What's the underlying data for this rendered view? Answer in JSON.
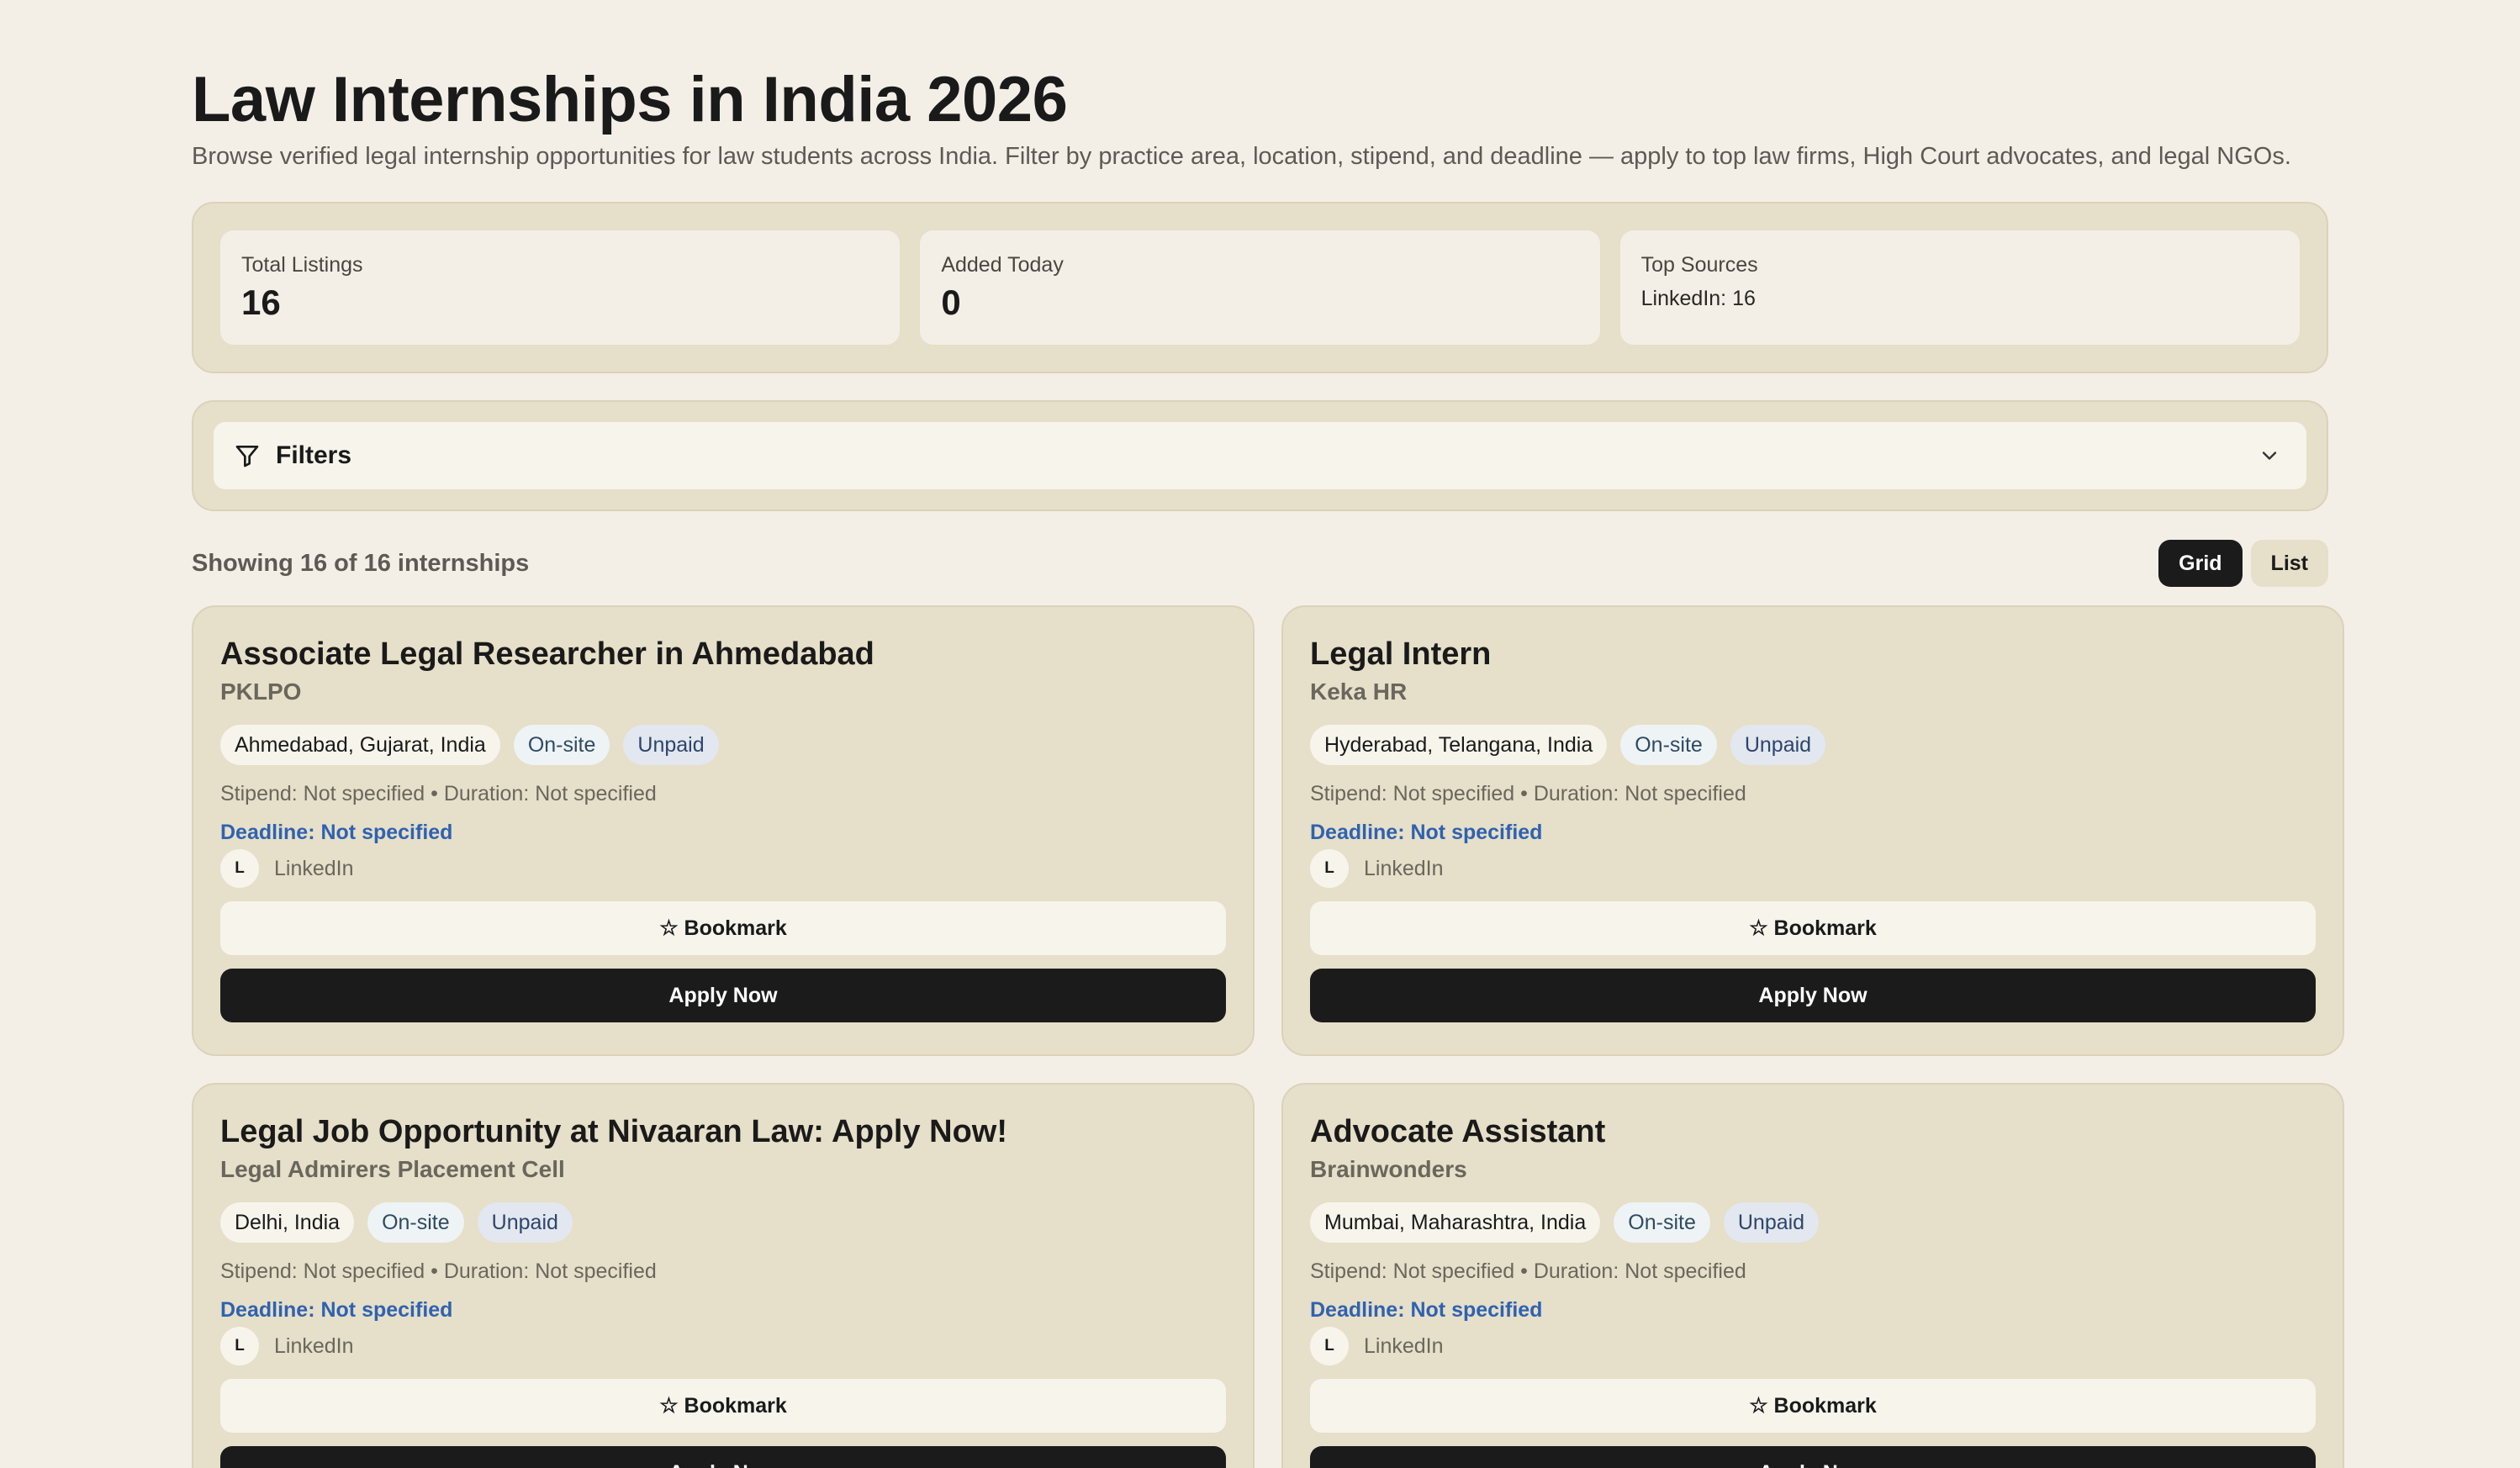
{
  "header": {
    "title": "Law Internships in India 2026",
    "description": "Browse verified legal internship opportunities for law students across India. Filter by practice area, location, stipend, and deadline — apply to top law firms, High Court advocates, and legal NGOs."
  },
  "stats": {
    "total_label": "Total Listings",
    "total_value": "16",
    "today_label": "Added Today",
    "today_value": "0",
    "sources_label": "Top Sources",
    "sources_value": "LinkedIn: 16"
  },
  "filters": {
    "label": "Filters"
  },
  "toolbar": {
    "showing": "Showing 16 of 16 internships",
    "grid_label": "Grid",
    "list_label": "List"
  },
  "cards": [
    {
      "title": "Associate Legal Researcher in Ahmedabad",
      "company": "PKLPO",
      "location": "Ahmedabad, Gujarat, India",
      "mode": "On-site",
      "pay": "Unpaid",
      "meta": "Stipend: Not specified • Duration: Not specified",
      "deadline": "Deadline: Not specified",
      "source_initial": "L",
      "source": "LinkedIn",
      "bookmark": "☆ Bookmark",
      "apply": "Apply Now"
    },
    {
      "title": "Legal Intern",
      "company": "Keka HR",
      "location": "Hyderabad, Telangana, India",
      "mode": "On-site",
      "pay": "Unpaid",
      "meta": "Stipend: Not specified • Duration: Not specified",
      "deadline": "Deadline: Not specified",
      "source_initial": "L",
      "source": "LinkedIn",
      "bookmark": "☆ Bookmark",
      "apply": "Apply Now"
    },
    {
      "title": "Legal Job Opportunity at Nivaaran Law: Apply Now!",
      "company": "Legal Admirers Placement Cell",
      "location": "Delhi, India",
      "mode": "On-site",
      "pay": "Unpaid",
      "meta": "Stipend: Not specified • Duration: Not specified",
      "deadline": "Deadline: Not specified",
      "source_initial": "L",
      "source": "LinkedIn",
      "bookmark": "☆ Bookmark",
      "apply": "Apply Now"
    },
    {
      "title": "Advocate Assistant",
      "company": "Brainwonders",
      "location": "Mumbai, Maharashtra, India",
      "mode": "On-site",
      "pay": "Unpaid",
      "meta": "Stipend: Not specified • Duration: Not specified",
      "deadline": "Deadline: Not specified",
      "source_initial": "L",
      "source": "LinkedIn",
      "bookmark": "☆ Bookmark",
      "apply": "Apply Now"
    }
  ]
}
